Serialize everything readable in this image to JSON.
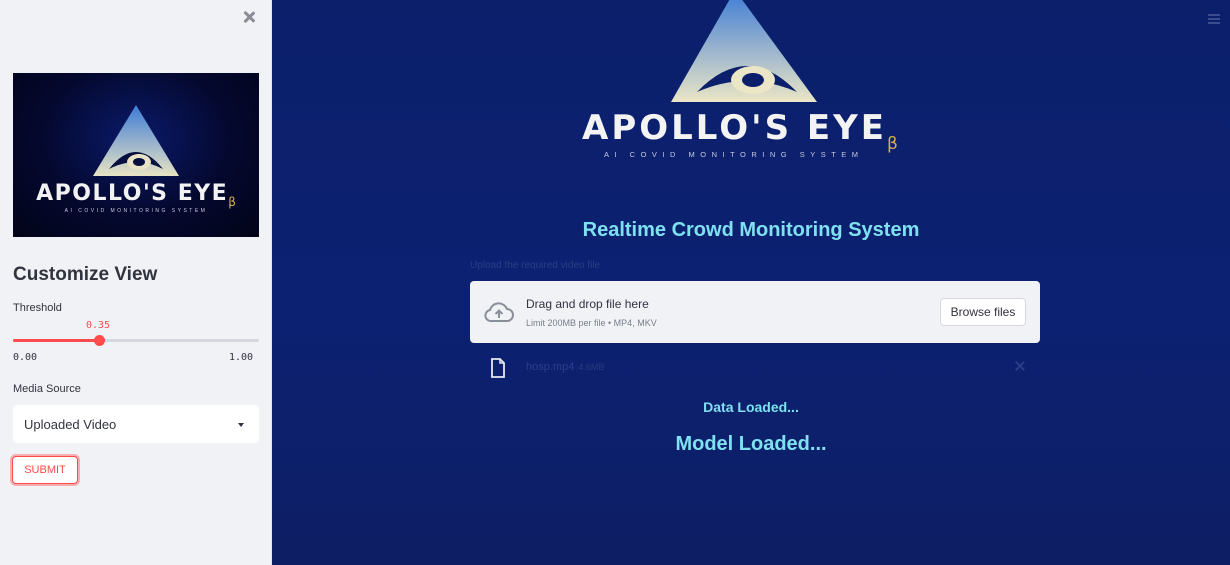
{
  "sidebar": {
    "logo": {
      "brand": "APOLLO'S EYE",
      "beta": "β",
      "tagline": "AI COVID MONITORING SYSTEM"
    },
    "section_title": "Customize View",
    "threshold": {
      "label": "Threshold",
      "value": "0.35",
      "value_fraction": 0.35,
      "min": "0.00",
      "max": "1.00"
    },
    "media_source": {
      "label": "Media Source",
      "selected": "Uploaded Video"
    },
    "submit_label": "SUBMIT"
  },
  "main": {
    "logo": {
      "brand": "APOLLO'S EYE",
      "beta": "β",
      "tagline": "AI COVID MONITORING SYSTEM"
    },
    "heading": "Realtime Crowd Monitoring System",
    "uploader": {
      "label": "Upload the required video file",
      "drop_title": "Drag and drop file here",
      "drop_limit": "Limit 200MB per file • MP4, MKV",
      "browse_label": "Browse files"
    },
    "file": {
      "name": "hosp.mp4",
      "size": "4.6MB"
    },
    "status": {
      "data_loaded": "Data Loaded...",
      "model_loaded": "Model Loaded..."
    }
  },
  "colors": {
    "accent": "#ff4b4b",
    "main_bg": "#0b1f6b",
    "heading": "#7fe0f0",
    "sidebar_bg": "#f0f2f6",
    "beta": "#d4b24a"
  },
  "icons": [
    "close-icon",
    "menu-icon",
    "cloud-upload-icon",
    "file-icon",
    "remove-icon",
    "chevron-down-icon",
    "eye-logo-icon"
  ]
}
